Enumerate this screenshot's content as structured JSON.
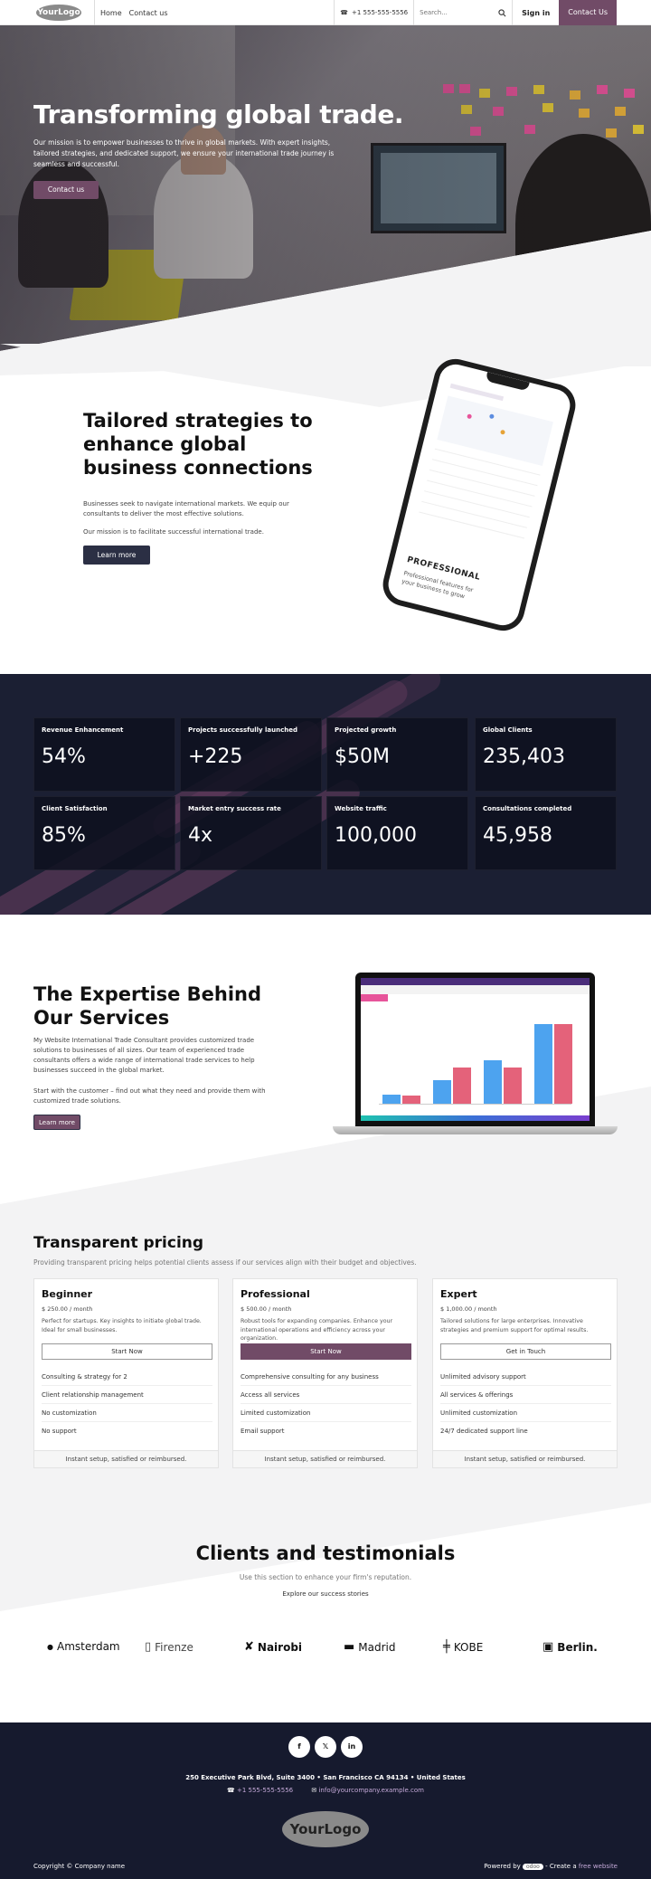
{
  "header": {
    "logo": "YourLogo",
    "nav": [
      "Home",
      "Contact us"
    ],
    "phone": "+1 555-555-5556",
    "search_placeholder": "Search...",
    "signin": "Sign in",
    "contact": "Contact Us"
  },
  "hero": {
    "title": "Transforming global trade.",
    "text": "Our mission is to empower businesses to thrive in global markets. With expert insights, tailored strategies, and dedicated support, we ensure your international trade journey is seamless and successful.",
    "button": "Contact us"
  },
  "tailored": {
    "title": "Tailored strategies to enhance global business connections",
    "p1": "Businesses seek to navigate international markets. We equip our consultants to deliver the most effective solutions.",
    "p2": "Our mission is to facilitate successful international trade.",
    "button": "Learn more",
    "phone_card_title": "PROFESSIONAL",
    "phone_card_text": "Professional features for your business to grow"
  },
  "stats": [
    {
      "label": "Revenue Enhancement",
      "value": "54%"
    },
    {
      "label": "Projects successfully launched",
      "value": "+225"
    },
    {
      "label": "Projected growth",
      "value": "$50M"
    },
    {
      "label": "Global Clients",
      "value": "235,403"
    },
    {
      "label": "Client Satisfaction",
      "value": "85%"
    },
    {
      "label": "Market entry success rate",
      "value": "4x"
    },
    {
      "label": "Website traffic",
      "value": "100,000"
    },
    {
      "label": "Consultations completed",
      "value": "45,958"
    }
  ],
  "expertise": {
    "title": "The Expertise Behind Our Services",
    "p1": "My Website International Trade Consultant provides customized trade solutions to businesses of all sizes. Our team of experienced trade consultants offers a wide range of international trade services to help businesses succeed in the global market.",
    "p2": "Start with the customer – find out what they need and provide them with customized trade solutions.",
    "button": "Learn more"
  },
  "pricing": {
    "title": "Transparent pricing",
    "subtitle": "Providing transparent pricing helps potential clients assess if our services align with their budget and objectives.",
    "plans": [
      {
        "name": "Beginner",
        "price": "$ 250.00 / month",
        "desc": "Perfect for startups. Key insights to initiate global trade. Ideal for small businesses.",
        "button": "Start Now",
        "features": [
          "Consulting & strategy for 2",
          "Client relationship management",
          "No customization",
          "No support"
        ],
        "footer": "Instant setup, satisfied or reimbursed."
      },
      {
        "name": "Professional",
        "price": "$ 500.00 / month",
        "desc": "Robust tools for expanding companies. Enhance your international operations and efficiency across your organization.",
        "button": "Start Now",
        "features": [
          "Comprehensive consulting for any business",
          "Access all services",
          "Limited customization",
          "Email support"
        ],
        "footer": "Instant setup, satisfied or reimbursed."
      },
      {
        "name": "Expert",
        "price": "$ 1,000.00 / month",
        "desc": "Tailored solutions for large enterprises. Innovative strategies and premium support for optimal results.",
        "button": "Get in Touch",
        "features": [
          "Unlimited advisory support",
          "All services & offerings",
          "Unlimited customization",
          "24/7 dedicated support line"
        ],
        "footer": "Instant setup, satisfied or reimbursed."
      }
    ]
  },
  "clients": {
    "title": "Clients and testimonials",
    "subtitle": "Use this section to enhance your firm's reputation.",
    "link": "Explore our success stories",
    "brands": [
      "Amsterdam",
      "Firenze",
      "Nairobi",
      "Madrid",
      "KOBE",
      "Berlin."
    ]
  },
  "footer": {
    "social": [
      "f",
      "𝕏",
      "in"
    ],
    "address": "250 Executive Park Blvd, Suite 3400 • San Francisco CA 94134 • United States",
    "phone": "+1 555-555-5556",
    "email": "info@yourcompany.example.com",
    "logo": "YourLogo",
    "copyright": "Copyright © Company name",
    "powered_prefix": "Powered by",
    "odoo": "odoo",
    "powered_mid": "- Create a",
    "powered_link": "free website"
  },
  "colors": {
    "accent": "#714b67",
    "dark": "#1b1f33",
    "button_dark": "#2b2f44"
  }
}
